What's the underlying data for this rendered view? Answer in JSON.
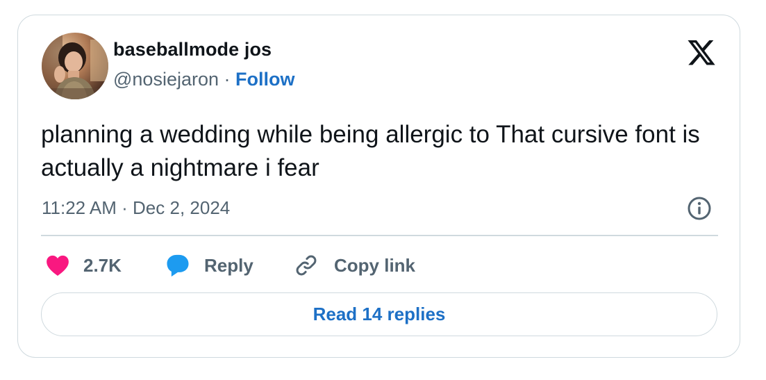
{
  "author": {
    "display_name": "baseballmode jos",
    "handle": "@nosiejaron",
    "separator": " · ",
    "follow_label": "Follow",
    "avatar_icon": "user-avatar-photo"
  },
  "brand": {
    "logo_icon": "x-logo-icon"
  },
  "tweet": {
    "text": "planning a wedding while being allergic to That cursive font is actually a nightmare i fear",
    "timestamp": "11:22 AM · Dec 2, 2024"
  },
  "actions": {
    "like_count": "2.7K",
    "like_icon": "heart-icon",
    "reply_label": "Reply",
    "reply_icon": "speech-bubble-icon",
    "copy_label": "Copy link",
    "copy_icon": "link-icon",
    "info_icon": "info-icon"
  },
  "footer": {
    "read_replies_label": "Read 14 replies"
  },
  "colors": {
    "accent_blue": "#1d70c6",
    "like_pink": "#f91880",
    "reply_blue": "#1d9bf0",
    "text_primary": "#0f1419",
    "text_secondary": "#536471",
    "border": "#cfd9de"
  }
}
